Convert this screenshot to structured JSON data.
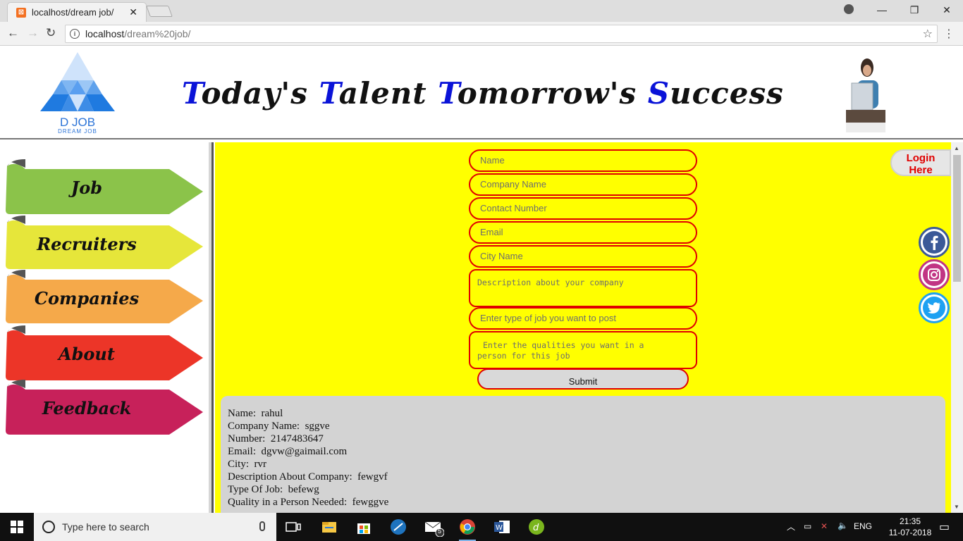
{
  "browser": {
    "tab_title": "localhost/dream job/",
    "tab_close": "✕",
    "url_host": "localhost",
    "url_path": "/dream%20job/",
    "window_controls": [
      "—",
      "❐",
      "✕"
    ]
  },
  "header": {
    "logo_text": "D JOB",
    "logo_sub": "DREAM JOB",
    "tagline": [
      {
        "cap": "T",
        "rest": "oday's "
      },
      {
        "cap": "T",
        "rest": "alent "
      },
      {
        "cap": "T",
        "rest": "omorrow's "
      },
      {
        "cap": "S",
        "rest": "uccess"
      }
    ]
  },
  "sidebar": {
    "items": [
      {
        "label": "Job",
        "color": "#8bc34a"
      },
      {
        "label": "Recruiters",
        "color": "#e6e63a"
      },
      {
        "label": "Companies",
        "color": "#f5a94a"
      },
      {
        "label": "About",
        "color": "#ec3528"
      },
      {
        "label": "Feedback",
        "color": "#c7215a"
      }
    ]
  },
  "form": {
    "name_placeholder": "Name",
    "company_placeholder": "Company Name",
    "contact_placeholder": "Contact Number",
    "email_placeholder": "Email",
    "city_placeholder": "City Name",
    "description_placeholder": "Description about your company",
    "job_type_placeholder": "Enter type of job you want to post",
    "qualities_placeholder_1": "Enter the qualities you want in a",
    "qualities_placeholder_2": "person for this job",
    "submit_label": "Submit"
  },
  "login": {
    "line1": "Login",
    "line2": "Here"
  },
  "result": {
    "lines": [
      "Name:  rahul",
      "Company Name:  sggve",
      "Number:  2147483647",
      "Email:  dgvw@gaimail.com",
      "City:  rvr",
      "Description About Company:  fewgvf",
      "Type Of Job:  befewg",
      "Quality in a Person Needed:  fewggve"
    ]
  },
  "taskbar": {
    "search_placeholder": "Type here to search",
    "language": "ENG",
    "time": "21:35",
    "date": "11-07-2018",
    "mail_badge": "5"
  },
  "colors": {
    "accent_red": "#e00000",
    "page_yellow": "#ffff00",
    "tagline_blue": "#0a13d8"
  }
}
